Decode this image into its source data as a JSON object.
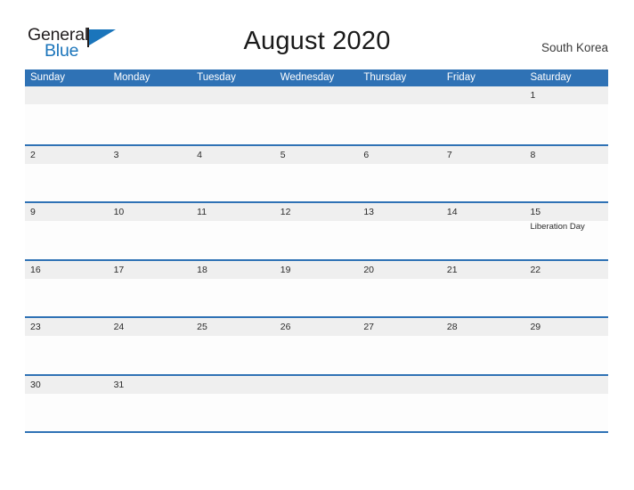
{
  "brand": {
    "name_part1": "General",
    "name_part2": "Blue",
    "color_dark": "#231f20",
    "color_blue": "#1b75bb"
  },
  "header": {
    "title": "August 2020",
    "country": "South Korea"
  },
  "theme": {
    "header_blue": "#2f72b5",
    "band_gray": "#efefef",
    "page_background": "#ffffff"
  },
  "calendar": {
    "weekday_headers": [
      "Sunday",
      "Monday",
      "Tuesday",
      "Wednesday",
      "Thursday",
      "Friday",
      "Saturday"
    ],
    "weeks": [
      {
        "days": [
          {
            "date": "",
            "events": []
          },
          {
            "date": "",
            "events": []
          },
          {
            "date": "",
            "events": []
          },
          {
            "date": "",
            "events": []
          },
          {
            "date": "",
            "events": []
          },
          {
            "date": "",
            "events": []
          },
          {
            "date": "1",
            "events": []
          }
        ]
      },
      {
        "days": [
          {
            "date": "2",
            "events": []
          },
          {
            "date": "3",
            "events": []
          },
          {
            "date": "4",
            "events": []
          },
          {
            "date": "5",
            "events": []
          },
          {
            "date": "6",
            "events": []
          },
          {
            "date": "7",
            "events": []
          },
          {
            "date": "8",
            "events": []
          }
        ]
      },
      {
        "days": [
          {
            "date": "9",
            "events": []
          },
          {
            "date": "10",
            "events": []
          },
          {
            "date": "11",
            "events": []
          },
          {
            "date": "12",
            "events": []
          },
          {
            "date": "13",
            "events": []
          },
          {
            "date": "14",
            "events": []
          },
          {
            "date": "15",
            "events": [
              "Liberation Day"
            ]
          }
        ]
      },
      {
        "days": [
          {
            "date": "16",
            "events": []
          },
          {
            "date": "17",
            "events": []
          },
          {
            "date": "18",
            "events": []
          },
          {
            "date": "19",
            "events": []
          },
          {
            "date": "20",
            "events": []
          },
          {
            "date": "21",
            "events": []
          },
          {
            "date": "22",
            "events": []
          }
        ]
      },
      {
        "days": [
          {
            "date": "23",
            "events": []
          },
          {
            "date": "24",
            "events": []
          },
          {
            "date": "25",
            "events": []
          },
          {
            "date": "26",
            "events": []
          },
          {
            "date": "27",
            "events": []
          },
          {
            "date": "28",
            "events": []
          },
          {
            "date": "29",
            "events": []
          }
        ]
      },
      {
        "days": [
          {
            "date": "30",
            "events": []
          },
          {
            "date": "31",
            "events": []
          },
          {
            "date": "",
            "events": []
          },
          {
            "date": "",
            "events": []
          },
          {
            "date": "",
            "events": []
          },
          {
            "date": "",
            "events": []
          },
          {
            "date": "",
            "events": []
          }
        ]
      }
    ]
  }
}
